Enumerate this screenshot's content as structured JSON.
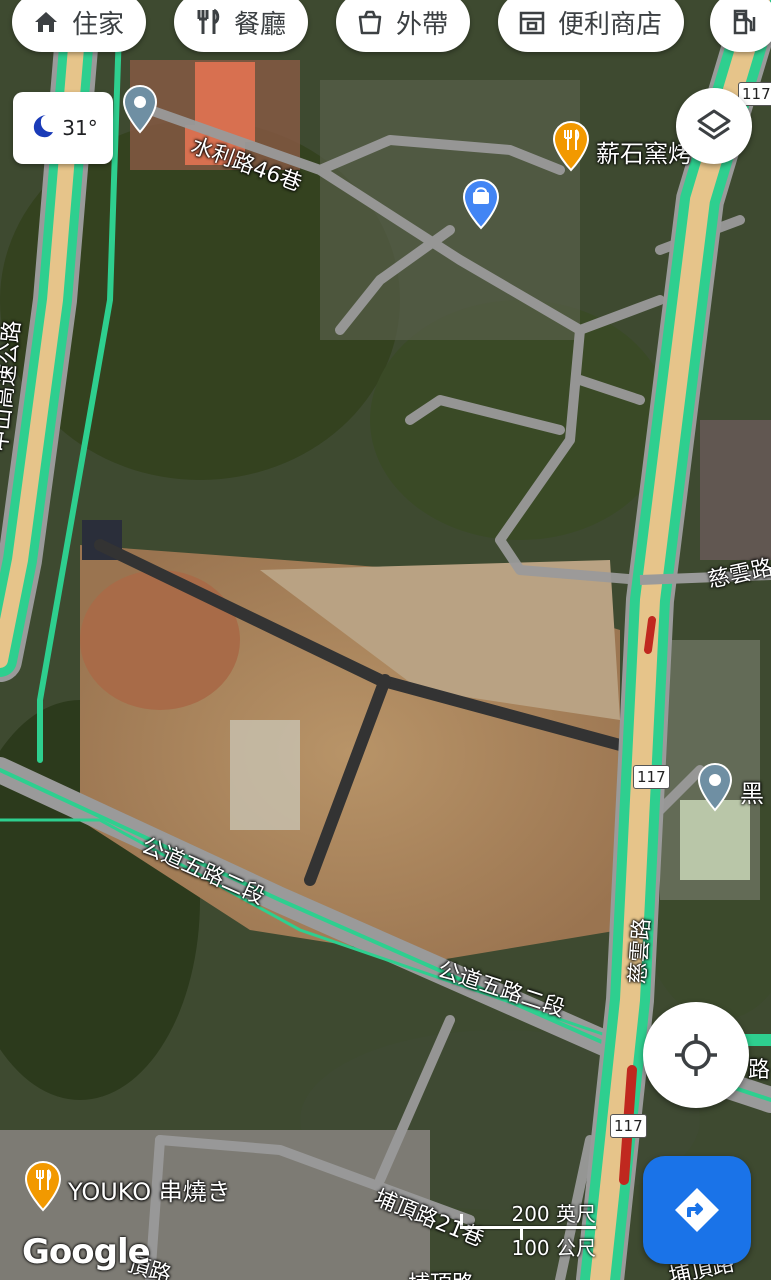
{
  "categories": [
    {
      "label": "住家",
      "icon": "home-icon"
    },
    {
      "label": "餐廳",
      "icon": "restaurant-icon"
    },
    {
      "label": "外帶",
      "icon": "takeout-icon"
    },
    {
      "label": "便利商店",
      "icon": "convenience-store-icon"
    },
    {
      "label": "",
      "icon": "gas-station-icon"
    }
  ],
  "weather": {
    "temp": "31°",
    "icon": "moon-icon"
  },
  "road_labels": {
    "water_lane": "水利路46巷",
    "zhongshan_fwy": "中山高速公路",
    "ciyun_east": "慈雲路",
    "ciyun_main": "慈雲路",
    "gongdao_1": "公道五路二段",
    "gongdao_2": "公道五路二段",
    "buding": "埔頂路21巷",
    "bottom_left": "頂路",
    "bottom_mid": "埔頂路",
    "bottom_right": "埔頂路",
    "right_edge": "路"
  },
  "shields": {
    "s1": "117",
    "s2": "117",
    "s3": "117"
  },
  "pois": {
    "xinshi": "薪石窯烤",
    "hei": "黑",
    "youko": "YOUKO 串燒き"
  },
  "scale": {
    "imperial": "200 英尺",
    "metric": "100 公尺"
  },
  "branding": {
    "logo": "Google"
  },
  "colors": {
    "highway": "#2ecf8f",
    "road": "#9a9a9a",
    "accent": "#1a73e8",
    "poi_orange": "#f29900",
    "pin_gray": "#6f8fa3"
  }
}
